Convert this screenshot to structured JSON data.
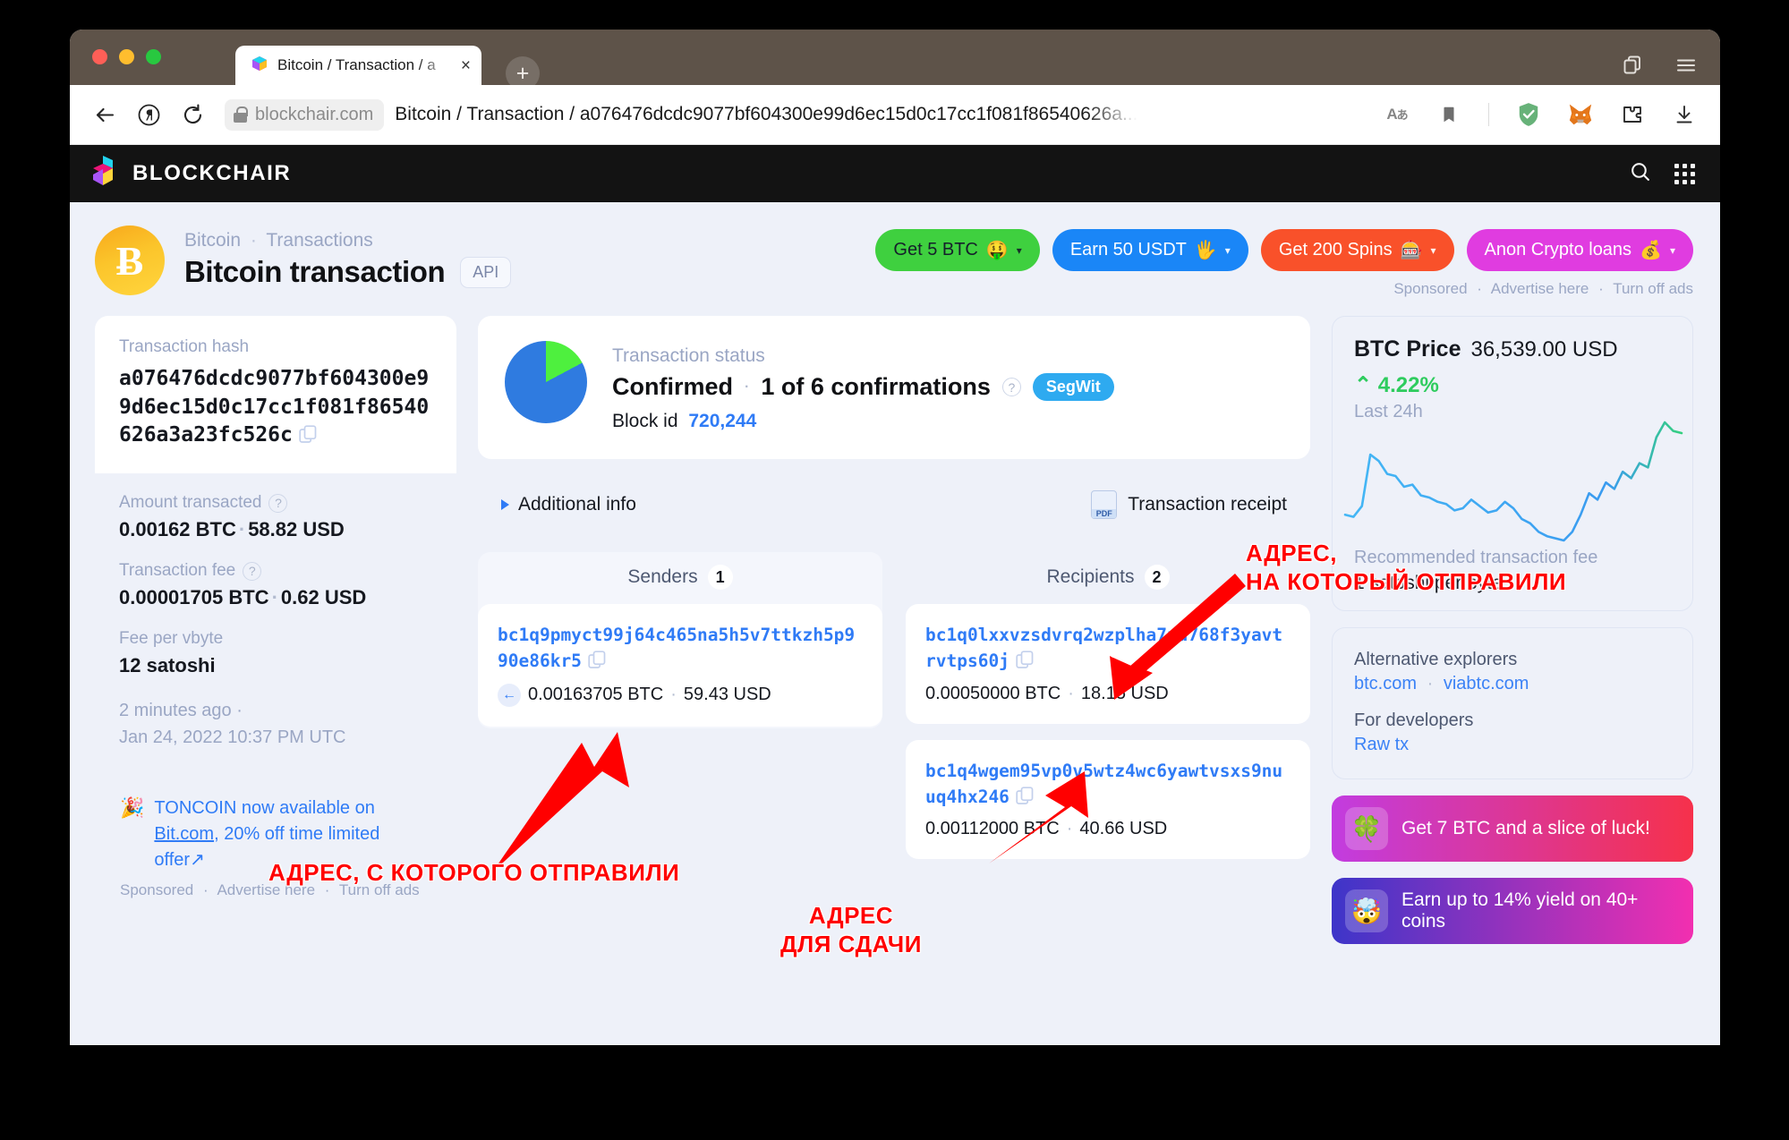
{
  "browser": {
    "tab_title": "Bitcoin / Transaction / a",
    "tab_close": "×",
    "newtab_label": "+",
    "host_chip": "blockchair.com",
    "url_text": "Bitcoin / Transaction / a076476dcdc9077bf604300e99d6ec15d0c17cc1f081f86540626a...",
    "tools": {
      "translate": "Aあ"
    }
  },
  "site": {
    "logo_text": "BLOCKCHAIR"
  },
  "header": {
    "coin_symbol": "Ƀ",
    "breadcrumb_root": "Bitcoin",
    "breadcrumb_sep": "·",
    "breadcrumb_section": "Transactions",
    "page_title": "Bitcoin transaction",
    "api_label": "API"
  },
  "ads": {
    "buttons": [
      {
        "label": "Get 5 BTC",
        "emoji": "🤑",
        "color": "#3fd03f",
        "text_dark": true
      },
      {
        "label": "Earn 50 USDT",
        "emoji": "🖐️",
        "color": "#1a86f7",
        "text_dark": false
      },
      {
        "label": "Get 200 Spins",
        "emoji": "🎰",
        "color": "#f9512a",
        "text_dark": false
      },
      {
        "label": "Anon Crypto loans",
        "emoji": "💰",
        "color": "#e03ce0",
        "text_dark": false
      }
    ],
    "caret": "▾",
    "sub": {
      "sponsored": "Sponsored",
      "advertise": "Advertise here",
      "turn_off": "Turn off ads",
      "sep": "·"
    }
  },
  "left": {
    "hash_label": "Transaction hash",
    "hash_value": "a076476dcdc9077bf604300e99d6ec15d0c17cc1f081f86540626a3a23fc526c",
    "amount_label": "Amount transacted",
    "amount_value": "0.00162 BTC",
    "amount_usd": "58.82 USD",
    "fee_label": "Transaction fee",
    "fee_value": "0.00001705 BTC",
    "fee_usd": "0.62 USD",
    "vbyte_label": "Fee per vbyte",
    "vbyte_value": "12 satoshi",
    "time_relative": "2 minutes ago ·",
    "time_absolute": "Jan 24, 2022 10:37 PM UTC",
    "help_mark": "?",
    "mid_dot": "·"
  },
  "toncoin": {
    "emoji": "🎉",
    "text_a": "TONCOIN now available on ",
    "link": "Bit.com",
    "text_b": ", 20% off time limited offer",
    "ext_arrow": "↗",
    "sponsored": "Sponsored",
    "advertise": "Advertise here",
    "turn_off": "Turn off ads",
    "sep": "·"
  },
  "status": {
    "label": "Transaction status",
    "confirmed": "Confirmed",
    "sep": "·",
    "confirmations": "1 of 6 confirmations",
    "help_mark": "?",
    "segwit": "SegWit",
    "block_label": "Block id",
    "block_value": "720,244",
    "pie_green_deg": 62,
    "pie_green": "#4ef03e",
    "pie_blue": "#2f7be0"
  },
  "additional": {
    "info_label": "Additional info",
    "receipt_label": "Transaction receipt",
    "pdf_label": "PDF"
  },
  "io": {
    "senders_label": "Senders",
    "senders_count": "1",
    "recipients_label": "Recipients",
    "recipients_count": "2",
    "arrow_left": "←",
    "mid_dot": "·",
    "senders": [
      {
        "address": "bc1q9pmyct99j64c465na5h5v7ttkzh5p990e86kr5",
        "btc": "0.00163705 BTC",
        "usd": "59.43 USD"
      }
    ],
    "recipients": [
      {
        "address": "bc1q0lxxvzsdvrq2wzplha7uu768f3yavtrvtps60j",
        "btc": "0.00050000 BTC",
        "usd": "18.15 USD"
      },
      {
        "address": "bc1q4wgem95vp0v5wtz4wc6yawtvsxs9nuuq4hx246",
        "btc": "0.00112000 BTC",
        "usd": "40.66 USD"
      }
    ]
  },
  "sidebar": {
    "price_label": "BTC Price",
    "price_value": "36,539.00 USD",
    "price_change": "⌃ 4.22%",
    "price_sub": "Last 24h",
    "fee_label": "Recommended transaction fee",
    "fee_value": "1 satoshi per byte",
    "alt_label": "Alternative explorers",
    "alt_links": [
      "btc.com",
      "viabtc.com"
    ],
    "alt_sep": "·",
    "dev_label": "For developers",
    "dev_link": "Raw tx",
    "promos": [
      {
        "emoji": "🍀",
        "text": "Get 7 BTC and a slice of luck!",
        "from": "#c23ce0",
        "to": "#f6314b"
      },
      {
        "emoji": "🤯",
        "text": "Earn up to 14% yield on 40+ coins",
        "from": "#3d35c9",
        "to": "#f22fb0"
      }
    ]
  },
  "annotations": [
    {
      "id": "to-address",
      "lines": "АДРЕС,\nНА КОТОРЫЙ ОТПРАВИЛИ"
    },
    {
      "id": "from-address",
      "lines": "АДРЕС, С КОТОРОГО ОТПРАВИЛИ"
    },
    {
      "id": "change-address",
      "lines": "АДРЕС\nДЛЯ СДАЧИ"
    }
  ],
  "chart_data": {
    "type": "line",
    "title": "BTC Price",
    "subtitle": "Last 24h",
    "current_value": 36539.0,
    "unit": "USD",
    "change_pct": 4.22,
    "series": [
      {
        "name": "BTC/USD last 24h",
        "values": [
          34900,
          34850,
          35100,
          36300,
          36150,
          35850,
          35800,
          35550,
          35600,
          35350,
          35300,
          35200,
          35150,
          35000,
          35050,
          35250,
          35100,
          34950,
          35000,
          35200,
          35050,
          34800,
          34700,
          34500,
          34400,
          34350,
          34300,
          34500,
          34900,
          35400,
          35250,
          35650,
          35500,
          35900,
          35750,
          36100,
          36000,
          36700,
          37050,
          36850,
          36800
        ]
      }
    ],
    "grid": false,
    "legend": "none"
  }
}
